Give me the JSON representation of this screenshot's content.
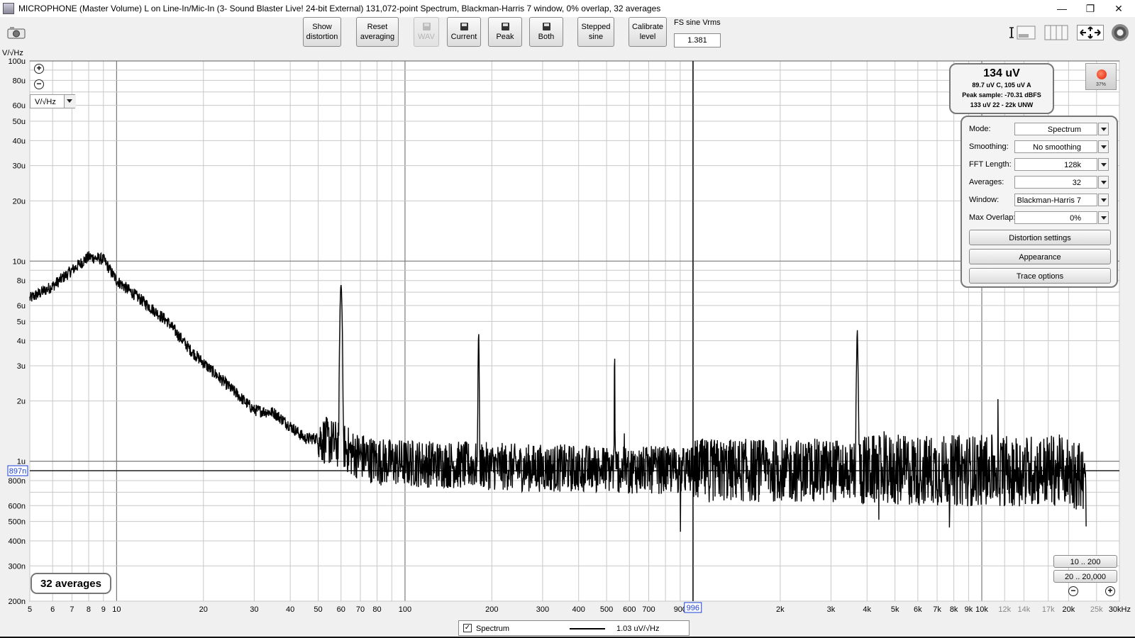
{
  "window": {
    "title": "MICROPHONE (Master Volume) L on Line-In/Mic-In (3- Sound Blaster Live! 24-bit External) 131,072-point Spectrum, Blackman-Harris 7 window, 0% overlap, 32 averages",
    "minimize": "—",
    "restore": "❐",
    "close": "✕"
  },
  "toolbar": {
    "show_distortion": [
      "Show",
      "distortion"
    ],
    "reset_averaging": [
      "Reset",
      "averaging"
    ],
    "wav": "WAV",
    "current": "Current",
    "peak": "Peak",
    "both": "Both",
    "stepped_sine": [
      "Stepped",
      "sine"
    ],
    "calibrate_level": [
      "Calibrate",
      "level"
    ],
    "fs_label": "FS sine Vrms",
    "fs_value": "1.381"
  },
  "plot": {
    "y_unit": "V/√Hz",
    "units_select": "V/√Hz",
    "y_ticks": [
      {
        "v": 0.0001,
        "label": "100u"
      },
      {
        "v": 8e-05,
        "label": "80u"
      },
      {
        "v": 6e-05,
        "label": "60u"
      },
      {
        "v": 5e-05,
        "label": "50u"
      },
      {
        "v": 4e-05,
        "label": "40u"
      },
      {
        "v": 3e-05,
        "label": "30u"
      },
      {
        "v": 2e-05,
        "label": "20u"
      },
      {
        "v": 1e-05,
        "label": "10u"
      },
      {
        "v": 8e-06,
        "label": "8u"
      },
      {
        "v": 6e-06,
        "label": "6u"
      },
      {
        "v": 5e-06,
        "label": "5u"
      },
      {
        "v": 4e-06,
        "label": "4u"
      },
      {
        "v": 3e-06,
        "label": "3u"
      },
      {
        "v": 2e-06,
        "label": "2u"
      },
      {
        "v": 1e-06,
        "label": "1u"
      },
      {
        "v": 8e-07,
        "label": "800n"
      },
      {
        "v": 6e-07,
        "label": "600n"
      },
      {
        "v": 5e-07,
        "label": "500n"
      },
      {
        "v": 4e-07,
        "label": "400n"
      },
      {
        "v": 3e-07,
        "label": "300n"
      },
      {
        "v": 2e-07,
        "label": "200n"
      }
    ],
    "x_ticks": [
      {
        "v": 5,
        "label": "5"
      },
      {
        "v": 6,
        "label": "6"
      },
      {
        "v": 7,
        "label": "7"
      },
      {
        "v": 8,
        "label": "8"
      },
      {
        "v": 9,
        "label": "9"
      },
      {
        "v": 10,
        "label": "10"
      },
      {
        "v": 20,
        "label": "20"
      },
      {
        "v": 30,
        "label": "30"
      },
      {
        "v": 40,
        "label": "40"
      },
      {
        "v": 50,
        "label": "50"
      },
      {
        "v": 60,
        "label": "60"
      },
      {
        "v": 70,
        "label": "70"
      },
      {
        "v": 80,
        "label": "80"
      },
      {
        "v": 100,
        "label": "100"
      },
      {
        "v": 200,
        "label": "200"
      },
      {
        "v": 300,
        "label": "300"
      },
      {
        "v": 400,
        "label": "400"
      },
      {
        "v": 500,
        "label": "500"
      },
      {
        "v": 600,
        "label": "600"
      },
      {
        "v": 700,
        "label": "700"
      },
      {
        "v": 900,
        "label": "900"
      },
      {
        "v": 2000,
        "label": "2k"
      },
      {
        "v": 3000,
        "label": "3k"
      },
      {
        "v": 4000,
        "label": "4k"
      },
      {
        "v": 5000,
        "label": "5k"
      },
      {
        "v": 6000,
        "label": "6k"
      },
      {
        "v": 7000,
        "label": "7k"
      },
      {
        "v": 8000,
        "label": "8k"
      },
      {
        "v": 9000,
        "label": "9k"
      },
      {
        "v": 10000,
        "label": "10k"
      },
      {
        "v": 12000,
        "label": "12k"
      },
      {
        "v": 14000,
        "label": "14k"
      },
      {
        "v": 17000,
        "label": "17k"
      },
      {
        "v": 20000,
        "label": "20k"
      },
      {
        "v": 25000,
        "label": "25k"
      },
      {
        "v": 30000,
        "label": "30kHz"
      }
    ],
    "cursor_x_label": "996",
    "cursor_y_label": "897n"
  },
  "chart_data": {
    "type": "line",
    "xlabel": "Hz",
    "ylabel": "V/√Hz",
    "x_scale": "log",
    "y_scale": "log",
    "xlim": [
      5,
      30000
    ],
    "ylim": [
      2e-07,
      0.0001
    ],
    "grid": true,
    "series": [
      {
        "name": "Spectrum",
        "x": [
          5,
          6,
          7,
          8,
          9,
          10,
          12,
          15,
          18,
          20,
          25,
          30,
          35,
          40,
          45,
          50,
          55,
          59,
          60,
          61,
          65,
          80,
          100,
          150,
          179,
          180,
          181,
          250,
          400,
          532,
          533,
          534,
          900,
          2000,
          3500,
          3690,
          3700,
          3710,
          4000,
          10000,
          20000,
          22000,
          23000
        ],
        "y": [
          6.5e-06,
          7.5e-06,
          9e-06,
          1.05e-05,
          1.02e-05,
          8e-06,
          6.5e-06,
          5e-06,
          3.6e-06,
          3.1e-06,
          2.3e-06,
          1.8e-06,
          1.75e-06,
          1.5e-06,
          1.3e-06,
          1.3e-06,
          1.25e-06,
          1.2e-06,
          7.6e-06,
          1.2e-06,
          1.1e-06,
          1e-06,
          9.8e-07,
          9.6e-07,
          9.5e-07,
          4.4e-06,
          9.5e-07,
          9.3e-07,
          9.2e-07,
          9.1e-07,
          3.8e-06,
          9.1e-07,
          9e-07,
          9e-07,
          9e-07,
          9e-07,
          4.6e-06,
          9e-07,
          9e-07,
          9e-07,
          9e-07,
          8.5e-07,
          7e-07
        ]
      }
    ]
  },
  "readout": {
    "rms": "134 uV",
    "weighted": "89.7 uV C, 105 uV A",
    "peak": "Peak sample: -70.31 dBFS",
    "unw": "133 uV 22 - 22k UNW"
  },
  "record": {
    "pct": "37%"
  },
  "settings": {
    "mode_label": "Mode:",
    "mode_value": "Spectrum",
    "smoothing_label": "Smoothing:",
    "smoothing_value": "No  smoothing",
    "fft_label": "FFT Length:",
    "fft_value": "128k",
    "averages_label": "Averages:",
    "averages_value": "32",
    "window_label": "Window:",
    "window_value": "Blackman-Harris 7",
    "overlap_label": "Max Overlap:",
    "overlap_value": "0%",
    "distortion_settings": "Distortion settings",
    "appearance": "Appearance",
    "trace_options": "Trace options"
  },
  "averages_badge": "32 averages",
  "range_buttons": {
    "r1": "10 .. 200",
    "r2": "20 .. 20,000"
  },
  "legend": {
    "name": "Spectrum",
    "value": "1.03 uV/√Hz",
    "checked": "✓"
  },
  "colors": {
    "trace": "#000000",
    "grid_major": "#8c8c8c",
    "grid_minor": "#c8c8c8",
    "plot_bg": "#ffffff",
    "cursor_label": "#1a3fd6"
  }
}
